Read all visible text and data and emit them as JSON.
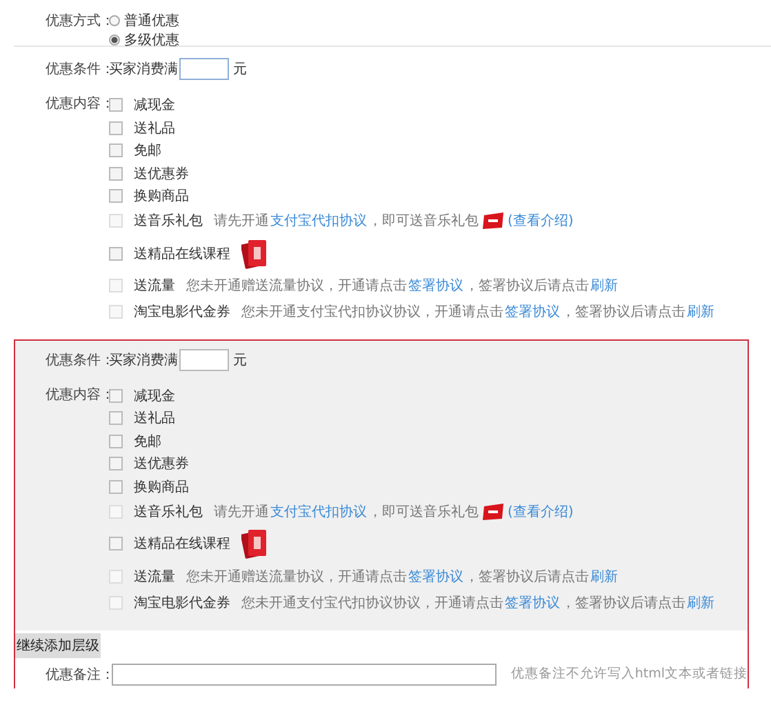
{
  "discount_mode": {
    "label": "优惠方式：",
    "options": [
      {
        "label": "普通优惠",
        "selected": false
      },
      {
        "label": "多级优惠",
        "selected": true
      }
    ]
  },
  "levels": [
    {
      "condition_label": "优惠条件：",
      "condition_prefix": "买家消费满",
      "unit": "元",
      "content_label": "优惠内容：",
      "items": [
        {
          "label": "减现金",
          "checked": false,
          "kind": "plain",
          "disabled": false
        },
        {
          "label": "送礼品",
          "checked": false,
          "kind": "plain",
          "disabled": false
        },
        {
          "label": "免邮",
          "checked": false,
          "kind": "plain",
          "disabled": false
        },
        {
          "label": "送优惠券",
          "checked": false,
          "kind": "plain",
          "disabled": false
        },
        {
          "label": "换购商品",
          "checked": false,
          "kind": "plain",
          "disabled": false
        },
        {
          "label": "送音乐礼包",
          "checked": false,
          "kind": "note",
          "disabled": true,
          "note": [
            {
              "kind": "text",
              "text": "请先开通"
            },
            {
              "kind": "link",
              "text": "支付宝代扣协议"
            },
            {
              "kind": "text",
              "text": "，即可送音乐礼包"
            },
            {
              "kind": "badge"
            },
            {
              "kind": "link",
              "text": "(查看介绍)"
            }
          ]
        },
        {
          "label": "送精品在线课程",
          "checked": false,
          "kind": "gift",
          "disabled": false
        },
        {
          "label": "送流量",
          "checked": false,
          "kind": "note",
          "disabled": true,
          "note": [
            {
              "kind": "text",
              "text": "您未开通赠送流量协议，开通请点击"
            },
            {
              "kind": "link",
              "text": "签署协议"
            },
            {
              "kind": "text",
              "text": "，签署协议后请点击"
            },
            {
              "kind": "link",
              "text": "刷新"
            }
          ]
        },
        {
          "label": "淘宝电影代金券",
          "checked": false,
          "kind": "note",
          "disabled": true,
          "note": [
            {
              "kind": "text",
              "text": "您未开通支付宝代扣协议协议，开通请点击"
            },
            {
              "kind": "link",
              "text": "签署协议"
            },
            {
              "kind": "text",
              "text": "，签署协议后请点击"
            },
            {
              "kind": "link",
              "text": "刷新"
            }
          ]
        }
      ]
    },
    {
      "condition_label": "优惠条件：",
      "condition_prefix": "买家消费满",
      "unit": "元",
      "content_label": "优惠内容：",
      "items": [
        {
          "label": "减现金",
          "checked": false,
          "kind": "plain",
          "disabled": false
        },
        {
          "label": "送礼品",
          "checked": false,
          "kind": "plain",
          "disabled": false
        },
        {
          "label": "免邮",
          "checked": false,
          "kind": "plain",
          "disabled": false
        },
        {
          "label": "送优惠券",
          "checked": false,
          "kind": "plain",
          "disabled": false
        },
        {
          "label": "换购商品",
          "checked": false,
          "kind": "plain",
          "disabled": false
        },
        {
          "label": "送音乐礼包",
          "checked": false,
          "kind": "note",
          "disabled": true,
          "note": [
            {
              "kind": "text",
              "text": "请先开通"
            },
            {
              "kind": "link",
              "text": "支付宝代扣协议"
            },
            {
              "kind": "text",
              "text": "，即可送音乐礼包"
            },
            {
              "kind": "badge"
            },
            {
              "kind": "link",
              "text": "(查看介绍)"
            }
          ]
        },
        {
          "label": "送精品在线课程",
          "checked": false,
          "kind": "gift",
          "disabled": false
        },
        {
          "label": "送流量",
          "checked": false,
          "kind": "note",
          "disabled": true,
          "note": [
            {
              "kind": "text",
              "text": "您未开通赠送流量协议，开通请点击"
            },
            {
              "kind": "link",
              "text": "签署协议"
            },
            {
              "kind": "text",
              "text": "，签署协议后请点击"
            },
            {
              "kind": "link",
              "text": "刷新"
            }
          ]
        },
        {
          "label": "淘宝电影代金券",
          "checked": false,
          "kind": "note",
          "disabled": true,
          "note": [
            {
              "kind": "text",
              "text": "您未开通支付宝代扣协议协议，开通请点击"
            },
            {
              "kind": "link",
              "text": "签署协议"
            },
            {
              "kind": "text",
              "text": "，签署协议后请点击"
            },
            {
              "kind": "link",
              "text": "刷新"
            }
          ]
        }
      ]
    }
  ],
  "add_level_button": "继续添加层级",
  "remark": {
    "label": "优惠备注：",
    "hint": "优惠备注不允许写入html文本或者链接"
  }
}
